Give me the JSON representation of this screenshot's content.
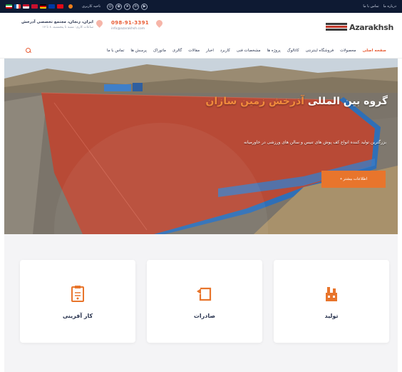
{
  "topbar": {
    "links": [
      "تماس با ما",
      "درباره ما"
    ],
    "user_label": "ناحیه کاربری",
    "social_icons": [
      "instagram-icon",
      "whatsapp-icon",
      "telegram-icon",
      "linkedin-icon",
      "aparat-icon"
    ]
  },
  "header": {
    "logo_text": "Azarakhsh",
    "address_title": "ایران، زنجان، مجتمع تخصصی آذرخش",
    "address_sub": "ساعات کاری: شنبه تا پنجشنبه، ۸ تا ۱۷",
    "phone": "098-91-3391",
    "email": "info@azarakhsh.com"
  },
  "nav": {
    "items": [
      "صفحه اصلی",
      "محصولات",
      "فروشگاه اینترنتی",
      "کاتالوگ",
      "پروژه ها",
      "مشخصات فنی",
      "کاربرد",
      "اخبار",
      "مقالات",
      "گالری",
      "ماتوراک",
      "پرسش ها",
      "تماس با ما"
    ],
    "active_index": 0
  },
  "hero": {
    "title_part1": "گروه بین المللی",
    "title_highlight": "آذرخش",
    "title_part2": "زمین سازان",
    "subtitle": "بزرگترین تولید کننده انواع کف پوش های تنیس و سالن های ورزشی در خاورمیانه",
    "button_label": "اطلاعات بیشتر +"
  },
  "services": {
    "cards": [
      {
        "label": "کار آفرینی",
        "icon": "document-icon"
      },
      {
        "label": "صادرات",
        "icon": "export-icon"
      },
      {
        "label": "تولید",
        "icon": "factory-icon"
      }
    ]
  },
  "colors": {
    "accent": "#e85d35",
    "topbar": "#0e1a33",
    "court": "#b84a36",
    "services_bg": "#f4f4f6"
  }
}
